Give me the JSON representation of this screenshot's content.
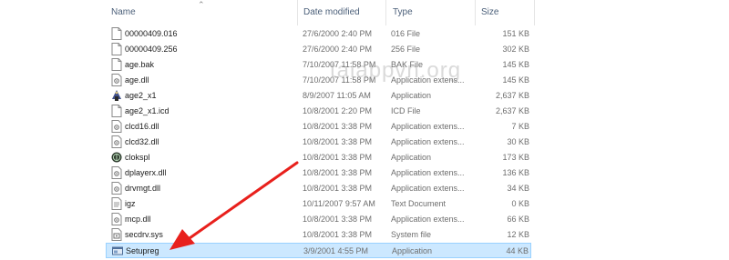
{
  "columns": {
    "name": "Name",
    "date": "Date modified",
    "type": "Type",
    "size": "Size"
  },
  "files": [
    {
      "name": "00000409.016",
      "date": "27/6/2000 2:40 PM",
      "type": "016 File",
      "size": "151 KB",
      "icon": "generic-file-icon"
    },
    {
      "name": "00000409.256",
      "date": "27/6/2000 2:40 PM",
      "type": "256 File",
      "size": "302 KB",
      "icon": "generic-file-icon"
    },
    {
      "name": "age.bak",
      "date": "7/10/2007 11:58 PM",
      "type": "BAK File",
      "size": "145 KB",
      "icon": "generic-file-icon"
    },
    {
      "name": "age.dll",
      "date": "7/10/2007 11:58 PM",
      "type": "Application extens...",
      "size": "145 KB",
      "icon": "dll-file-icon"
    },
    {
      "name": "age2_x1",
      "date": "8/9/2007 11:05 AM",
      "type": "Application",
      "size": "2,637 KB",
      "icon": "age-app-icon"
    },
    {
      "name": "age2_x1.icd",
      "date": "10/8/2001 2:20 PM",
      "type": "ICD File",
      "size": "2,637 KB",
      "icon": "generic-file-icon"
    },
    {
      "name": "clcd16.dll",
      "date": "10/8/2001 3:38 PM",
      "type": "Application extens...",
      "size": "7 KB",
      "icon": "dll-file-icon"
    },
    {
      "name": "clcd32.dll",
      "date": "10/8/2001 3:38 PM",
      "type": "Application extens...",
      "size": "30 KB",
      "icon": "dll-file-icon"
    },
    {
      "name": "clokspl",
      "date": "10/8/2001 3:38 PM",
      "type": "Application",
      "size": "173 KB",
      "icon": "clokspl-app-icon"
    },
    {
      "name": "dplayerx.dll",
      "date": "10/8/2001 3:38 PM",
      "type": "Application extens...",
      "size": "136 KB",
      "icon": "dll-file-icon"
    },
    {
      "name": "drvmgt.dll",
      "date": "10/8/2001 3:38 PM",
      "type": "Application extens...",
      "size": "34 KB",
      "icon": "dll-file-icon"
    },
    {
      "name": "igz",
      "date": "10/11/2007 9:57 AM",
      "type": "Text Document",
      "size": "0 KB",
      "icon": "text-file-icon"
    },
    {
      "name": "mcp.dll",
      "date": "10/8/2001 3:38 PM",
      "type": "Application extens...",
      "size": "66 KB",
      "icon": "dll-file-icon"
    },
    {
      "name": "secdrv.sys",
      "date": "10/8/2001 3:38 PM",
      "type": "System file",
      "size": "12 KB",
      "icon": "system-file-icon"
    },
    {
      "name": "Setupreg",
      "date": "3/9/2001 4:55 PM",
      "type": "Application",
      "size": "44 KB",
      "icon": "setup-app-icon",
      "selected": true
    }
  ],
  "watermark": "taiappvn.org",
  "colors": {
    "selection_bg": "#cce8ff",
    "selection_border": "#99d1ff",
    "arrow": "#e8201c",
    "header_text": "#4c607a"
  }
}
